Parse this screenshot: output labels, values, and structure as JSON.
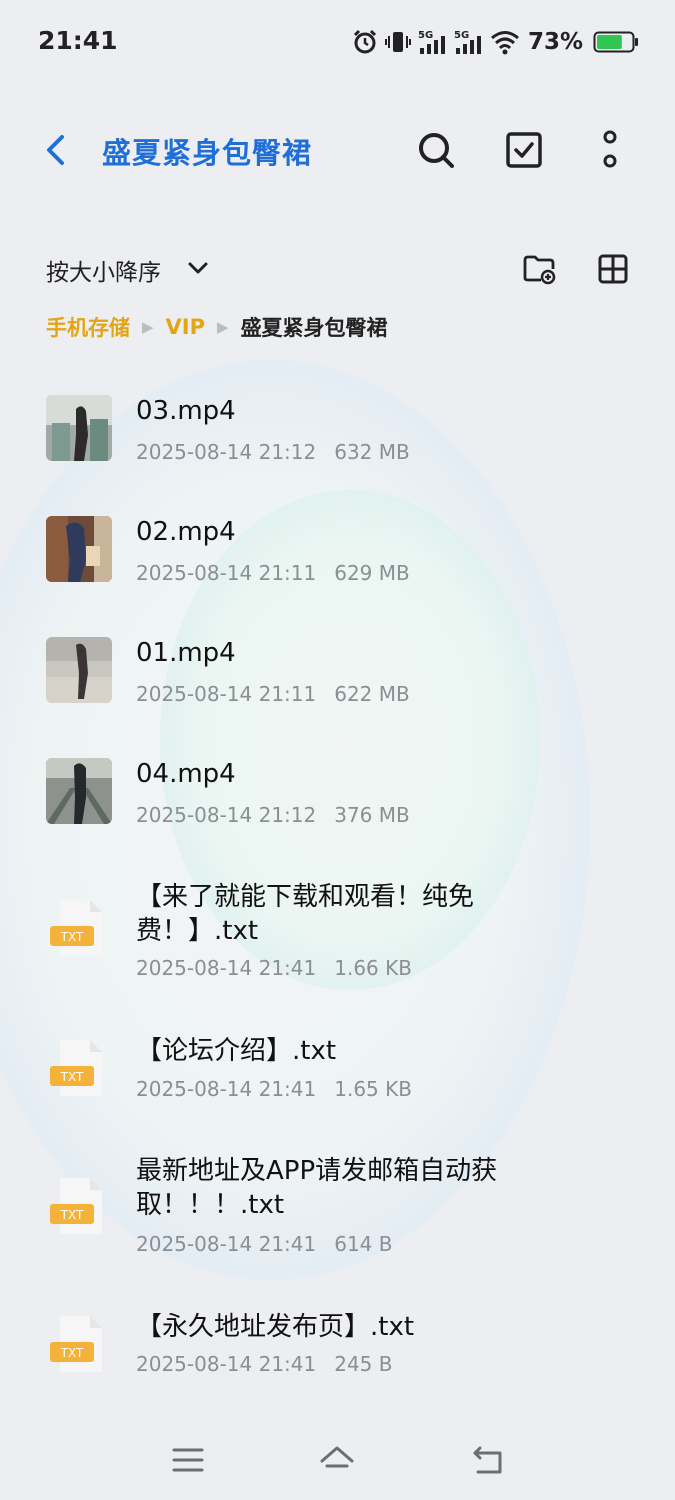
{
  "status_bar": {
    "time": "21:41",
    "battery_percent": "73%",
    "battery_level": 0.73,
    "network_1": "5G",
    "network_2": "5G"
  },
  "header": {
    "title": "盛夏紧身包臀裙",
    "accent_color": "#1f6fd6"
  },
  "sort": {
    "label": "按大小降序"
  },
  "breadcrumb": {
    "items": [
      "手机存储",
      "VIP"
    ],
    "current": "盛夏紧身包臀裙"
  },
  "files": [
    {
      "name": "03.mp4",
      "date": "2025-08-14 21:12",
      "size": "632 MB",
      "type": "video"
    },
    {
      "name": "02.mp4",
      "date": "2025-08-14 21:11",
      "size": "629 MB",
      "type": "video"
    },
    {
      "name": "01.mp4",
      "date": "2025-08-14 21:11",
      "size": "622 MB",
      "type": "video"
    },
    {
      "name": "04.mp4",
      "date": "2025-08-14 21:12",
      "size": "376 MB",
      "type": "video"
    },
    {
      "name": "【来了就能下载和观看！纯免费！】.txt",
      "date": "2025-08-14 21:41",
      "size": "1.66 KB",
      "type": "txt"
    },
    {
      "name": "【论坛介绍】.txt",
      "date": "2025-08-14 21:41",
      "size": "1.65 KB",
      "type": "txt"
    },
    {
      "name": "最新地址及APP请发邮箱自动获取！！！.txt",
      "date": "2025-08-14 21:41",
      "size": "614 B",
      "type": "txt"
    },
    {
      "name": "【永久地址发布页】.txt",
      "date": "2025-08-14 21:41",
      "size": "245 B",
      "type": "txt"
    }
  ],
  "txt_badge": "TXT",
  "icons": {
    "back": "back-arrow-icon",
    "search": "search-icon",
    "select": "checkbox-icon",
    "more": "more-vertical-icon",
    "sort_chevron": "chevron-down-icon",
    "new_folder": "new-folder-icon",
    "grid_view": "grid-view-icon",
    "nav_menu": "menu-icon",
    "nav_home": "home-icon",
    "nav_back": "back-icon"
  }
}
